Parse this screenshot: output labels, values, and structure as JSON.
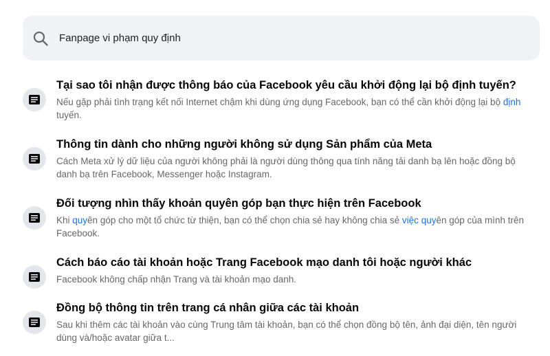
{
  "search": {
    "value": "Fanpage vi phạm quy định",
    "icon": "search-icon"
  },
  "colors": {
    "search_bg": "#f0f2f5",
    "title": "#050505",
    "snippet": "#65676b",
    "highlight": "#1b74e4",
    "icon_bg": "#e4e6eb"
  },
  "results": [
    {
      "icon": "article-icon",
      "title": "Tại sao tôi nhận được thông báo của Facebook yêu cầu khởi động lại bộ định tuyến?",
      "desc_parts": [
        "Nếu gặp phải tình trạng kết nối Internet chậm khi dùng ứng dụng Facebook, bạn có thể cần khởi động lại bộ ",
        "định",
        " tuyến."
      ]
    },
    {
      "icon": "article-icon",
      "title": "Thông tin dành cho những người không sử dụng Sản phẩm của Meta",
      "desc_parts": [
        "Cách Meta xử lý dữ liệu của người không phải là người dùng thông qua tính năng tải danh bạ lên hoặc đồng bộ danh bạ trên Facebook, Messenger hoặc Instagram."
      ]
    },
    {
      "icon": "article-icon",
      "title": "Đối tượng nhìn thấy khoản quyên góp bạn thực hiện trên Facebook",
      "desc_parts": [
        "Khi ",
        "quy",
        "ên góp cho một tổ chức từ thiện, bạn có thể chọn chia sẻ hay không chia sẻ ",
        "việc",
        " ",
        "quy",
        "ên góp của mình trên Facebook."
      ]
    },
    {
      "icon": "article-icon",
      "title": "Cách báo cáo tài khoản hoặc Trang Facebook mạo danh tôi hoặc người khác",
      "desc_parts": [
        "Facebook không chấp nhận Trang và tài khoản mạo danh."
      ]
    },
    {
      "icon": "article-icon",
      "title": "Đồng bộ thông tin trên trang cá nhân giữa các tài khoản",
      "desc_parts": [
        "Sau khi thêm các tài khoản vào cùng Trung tâm tài khoản, bạn có thể chọn đồng bộ tên, ảnh đại diện, tên người dùng và/hoặc avatar giữa t..."
      ]
    }
  ]
}
